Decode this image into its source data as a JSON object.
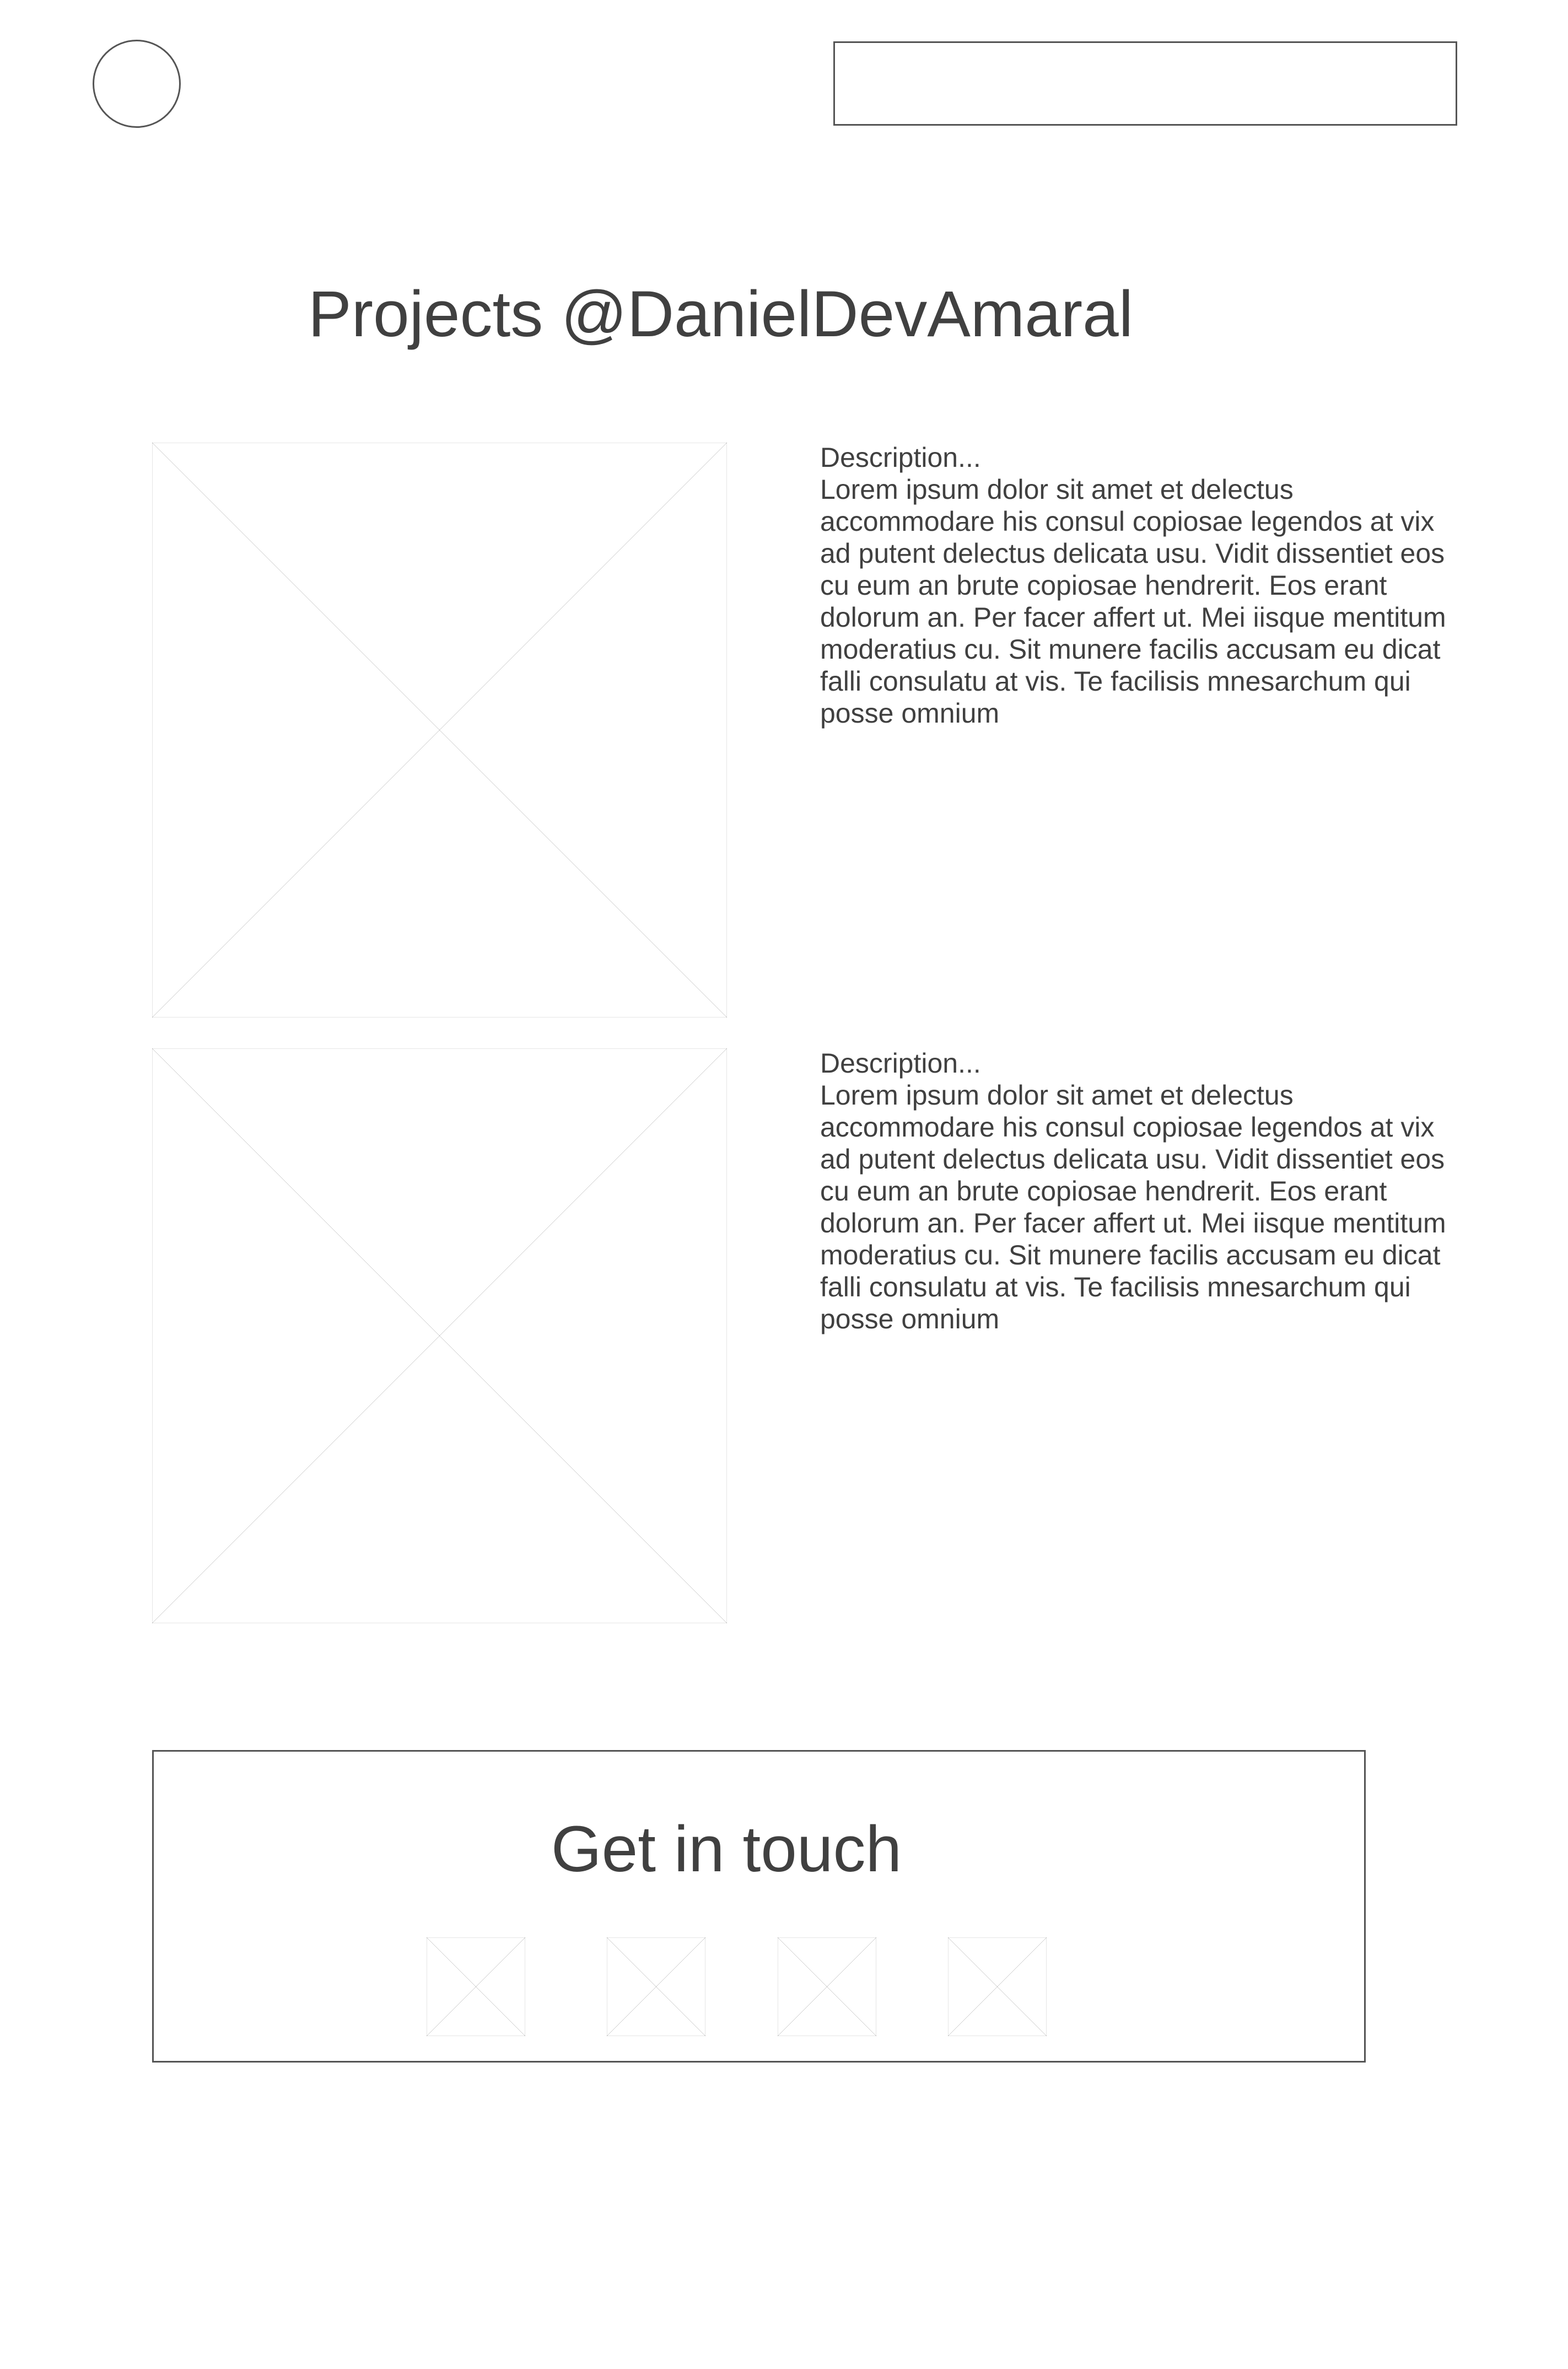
{
  "header": {
    "logo_icon": "circle-logo-icon",
    "nav_placeholder": ""
  },
  "page": {
    "title": "Projects @DanielDevAmaral"
  },
  "projects": [
    {
      "image_icon": "image-placeholder-icon",
      "heading": "Description...",
      "body": "Lorem ipsum dolor sit amet et delectus accommodare his consul copiosae legendos at vix ad putent delectus delicata usu. Vidit dissentiet eos cu eum an brute copiosae hendrerit. Eos erant dolorum an. Per facer affert ut. Mei iisque mentitum moderatius cu. Sit munere facilis accusam eu dicat falli consulatu at vis. Te facilisis mnesarchum qui posse omnium"
    },
    {
      "image_icon": "image-placeholder-icon",
      "heading": "Description...",
      "body": "Lorem ipsum dolor sit amet et delectus accommodare his consul copiosae legendos at vix ad putent delectus delicata usu. Vidit dissentiet eos cu eum an brute copiosae hendrerit. Eos erant dolorum an. Per facer affert ut. Mei iisque mentitum moderatius cu. Sit munere facilis accusam eu dicat falli consulatu at vis. Te facilisis mnesarchum qui posse omnium"
    }
  ],
  "contact": {
    "title": "Get in touch",
    "social_icons": [
      "image-placeholder-icon",
      "image-placeholder-icon",
      "image-placeholder-icon",
      "image-placeholder-icon"
    ]
  },
  "colors": {
    "stroke": "#555555",
    "text": "#404040",
    "background": "#ffffff"
  }
}
